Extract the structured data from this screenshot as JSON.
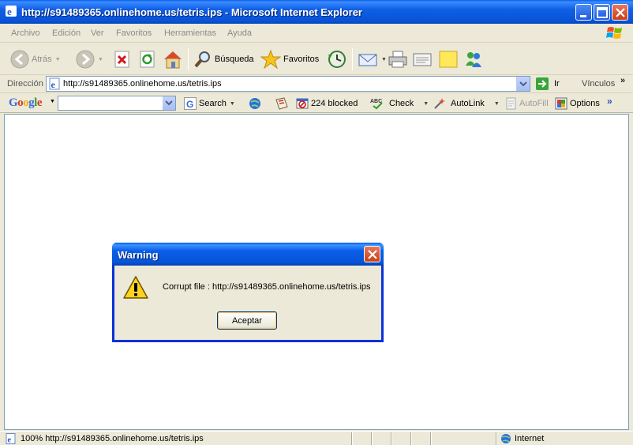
{
  "window": {
    "title": "http://s91489365.onlinehome.us/tetris.ips - Microsoft Internet Explorer"
  },
  "menu": [
    "Archivo",
    "Edición",
    "Ver",
    "Favoritos",
    "Herramientas",
    "Ayuda"
  ],
  "toolbar": {
    "back": "Atrás",
    "search": "Búsqueda",
    "favorites": "Favoritos"
  },
  "address": {
    "label": "Dirección",
    "url": "http://s91489365.onlinehome.us/tetris.ips",
    "go": "Ir",
    "links": "Vínculos"
  },
  "google": {
    "logo": "Google",
    "search": "Search",
    "blocked": "224 blocked",
    "check": "Check",
    "autolink": "AutoLink",
    "autofill": "AutoFill",
    "options": "Options"
  },
  "dialog": {
    "title": "Warning",
    "message": "Corrupt file : http://s91489365.onlinehome.us/tetris.ips",
    "ok": "Aceptar"
  },
  "status": {
    "text": "100%  http://s91489365.onlinehome.us/tetris.ips",
    "zone": "Internet"
  }
}
